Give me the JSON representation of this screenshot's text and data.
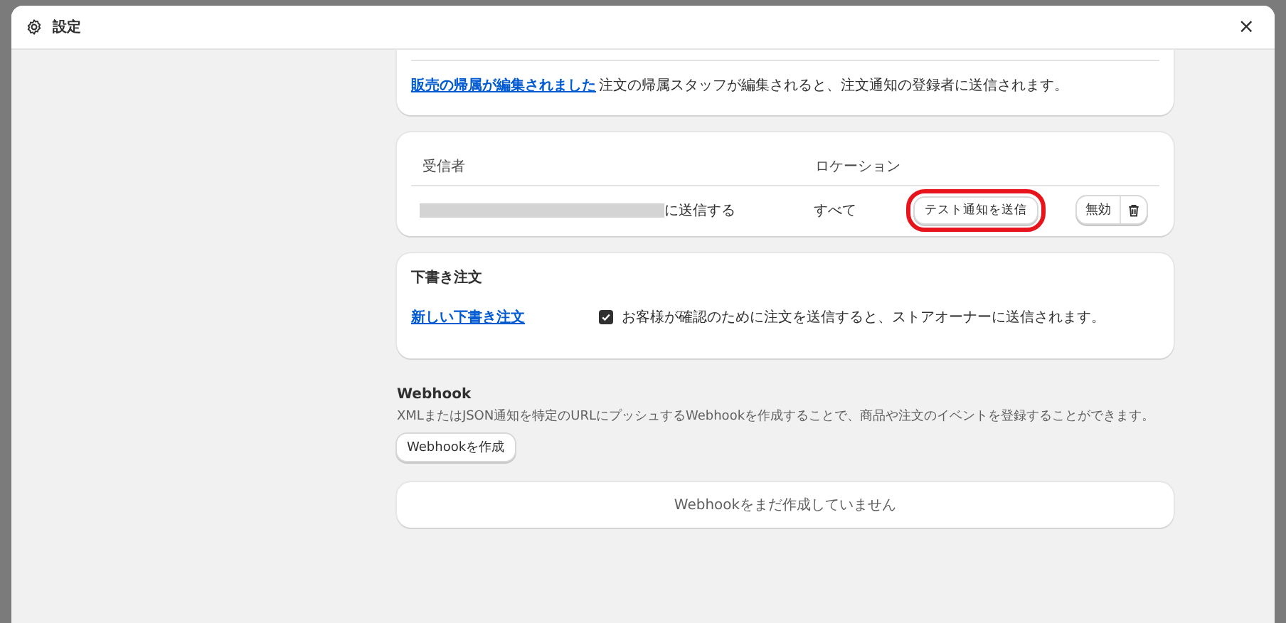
{
  "window": {
    "title": "設定",
    "close": "×"
  },
  "order_events": {
    "rows": [
      {
        "link": "販売の帰属が編集されました",
        "description": "注文の帰属スタッフが編集されると、注文通知の登録者に送信されます。"
      }
    ]
  },
  "recipients": {
    "columns": [
      "受信者",
      "ロケーション"
    ],
    "rows": [
      {
        "recipient_redacted": true,
        "recipient_suffix": "に送信する",
        "location": "すべて",
        "test_button": {
          "label": "テスト通知を送信",
          "highlighted": true
        },
        "disable_button": "無効"
      }
    ]
  },
  "draft_orders": {
    "title": "下書き注文",
    "rows": [
      {
        "link": "新しい下書き注文",
        "checked": true,
        "description": "お客様が確認のために注文を送信すると、ストアオーナーに送信されます。"
      }
    ]
  },
  "webhook": {
    "title": "Webhook",
    "description": "XMLまたはJSON通知を特定のURLにプッシュするWebhookを作成することで、商品や注文のイベントを登録することができます。",
    "create_button": "Webhookを作成",
    "empty_message": "Webhookをまだ作成していません"
  }
}
